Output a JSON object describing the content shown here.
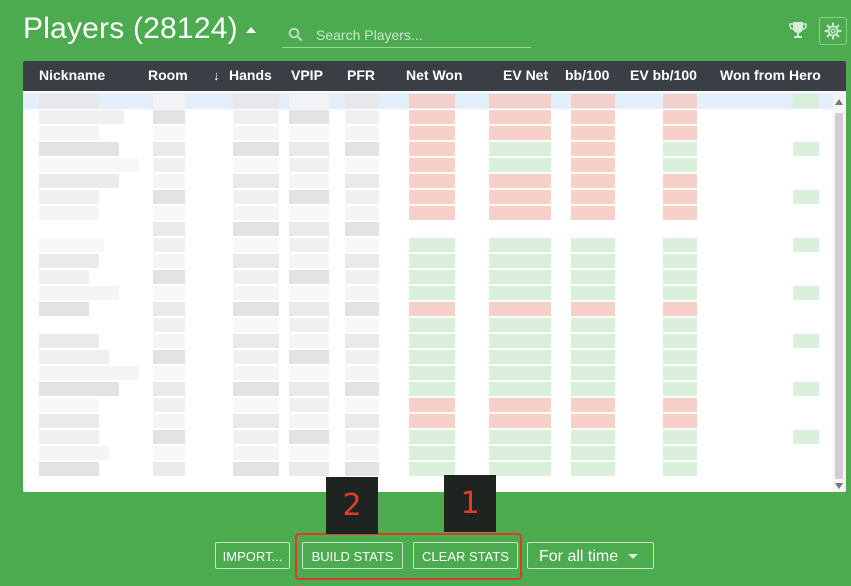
{
  "header": {
    "title": "Players (28124)",
    "search_placeholder": "Search Players..."
  },
  "table": {
    "columns": [
      "Nickname",
      "Room",
      "Hands",
      "VPIP",
      "PFR",
      "Net Won",
      "EV Net",
      "bb/100",
      "EV bb/100",
      "Won from Hero"
    ],
    "sort_column": "Hands",
    "sort_direction": "descending",
    "visible_rows": 24,
    "first_row_highlighted": true,
    "content_blurred": true,
    "row_tones": {
      "net_won": [
        "red",
        "red",
        "red",
        "red",
        "red",
        "red",
        "red",
        "red",
        "none",
        "green",
        "green",
        "green",
        "green",
        "red",
        "green",
        "green",
        "green",
        "green",
        "green",
        "red",
        "red",
        "green",
        "green",
        "green"
      ],
      "ev_net": [
        "red",
        "red",
        "red",
        "green",
        "green",
        "red",
        "red",
        "red",
        "none",
        "green",
        "green",
        "green",
        "green",
        "red",
        "green",
        "green",
        "green",
        "green",
        "green",
        "red",
        "red",
        "green",
        "green",
        "green"
      ]
    }
  },
  "footer": {
    "import_label": "IMPORT...",
    "build_stats_label": "BUILD STATS",
    "clear_stats_label": "CLEAR STATS",
    "period_value": "For all time"
  },
  "annotations": {
    "badge_build": "2",
    "badge_clear": "1",
    "highlight_color": "#e0382b"
  },
  "colors": {
    "background": "#4caa4f",
    "table_header": "#3a3f45",
    "row_highlight": "#e3f0fb",
    "negative_tint": "#f6c9c0",
    "positive_tint": "#d5edd3"
  }
}
